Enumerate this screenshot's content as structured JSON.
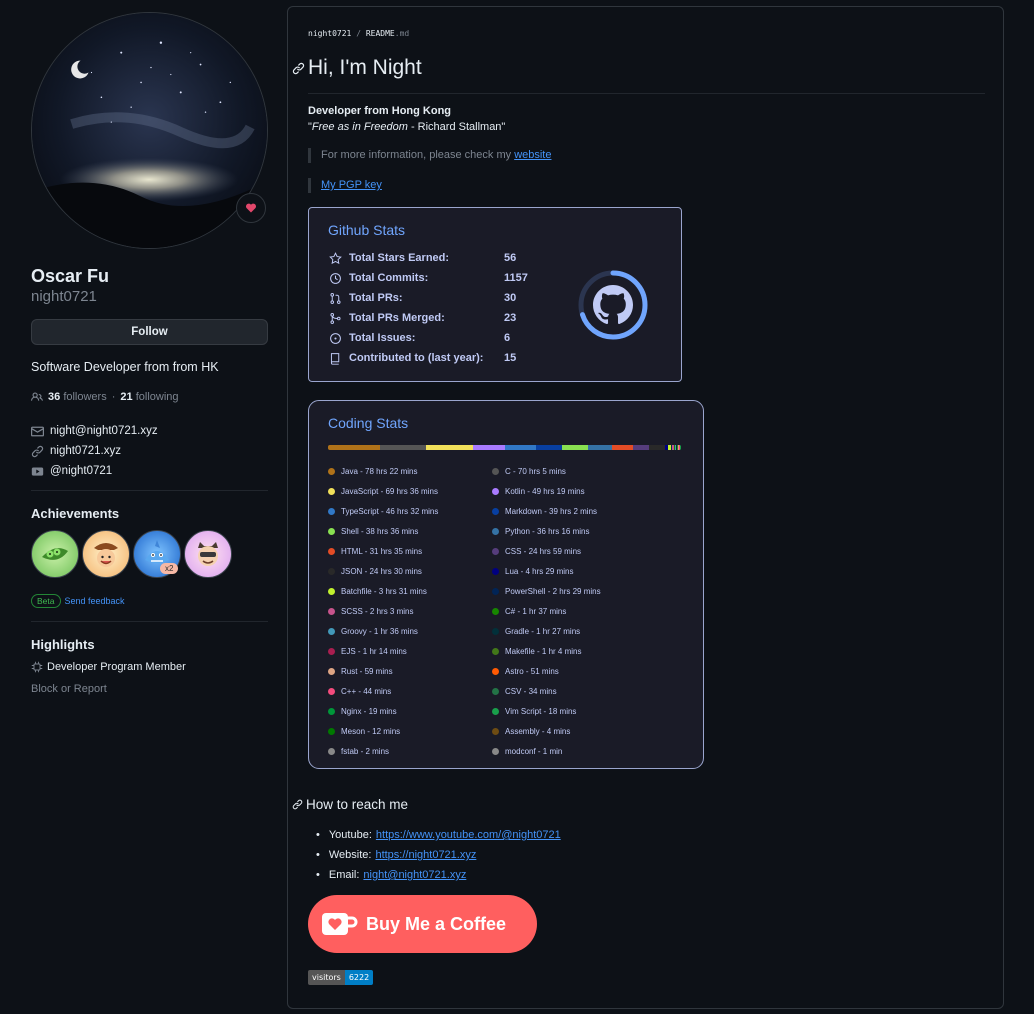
{
  "profile": {
    "name": "Oscar Fu",
    "login": "night0721",
    "follow_label": "Follow",
    "bio": "Software Developer from from HK",
    "followers_count": "36",
    "followers_label": "followers",
    "following_count": "21",
    "following_label": "following",
    "email": "night@night0721.xyz",
    "website": "night0721.xyz",
    "youtube": "@night0721",
    "achievements_title": "Achievements",
    "achievement_x2": "x2",
    "beta_label": "Beta",
    "feedback_label": "Send feedback",
    "highlights_title": "Highlights",
    "highlight_item": "Developer Program Member",
    "block_label": "Block or Report"
  },
  "readme": {
    "crumb_user": "night0721",
    "crumb_sep": "/",
    "crumb_file": "README",
    "crumb_ext": ".md",
    "title": "Hi, I'm Night",
    "developer_line": "Developer from Hong Kong",
    "quote_open": "\"",
    "quote_italic": "Free as in Freedom",
    "quote_rest": " - Richard Stallman\"",
    "info_text": "For more information, please check my ",
    "info_link": "website",
    "pgp_link": "My PGP key",
    "reach_title": "How to reach me",
    "reach": [
      {
        "label": "Youtube:",
        "link": "https://www.youtube.com/@night0721"
      },
      {
        "label": "Website:",
        "link": "https://night0721.xyz"
      },
      {
        "label": "Email:",
        "link": "night@night0721.xyz"
      }
    ],
    "bmc_label": "Buy Me a Coffee",
    "visitors_label": "visitors",
    "visitors_count": "6222"
  },
  "github_stats": {
    "title": "Github Stats",
    "rows": [
      {
        "label": "Total Stars Earned:",
        "value": "56",
        "icon": "star-icon"
      },
      {
        "label": "Total Commits:",
        "value": "1157",
        "icon": "history-icon"
      },
      {
        "label": "Total PRs:",
        "value": "30",
        "icon": "pull-request-icon"
      },
      {
        "label": "Total PRs Merged:",
        "value": "23",
        "icon": "merge-icon"
      },
      {
        "label": "Total Issues:",
        "value": "6",
        "icon": "issue-icon"
      },
      {
        "label": "Contributed to (last year):",
        "value": "15",
        "icon": "repo-icon"
      }
    ],
    "ring_fraction": 0.7,
    "accent": "#70a5fd",
    "text_color": "#c0caf5",
    "bg_color": "#1a1b27"
  },
  "coding_stats": {
    "title": "Coding Stats",
    "languages": [
      {
        "name": "Java",
        "time": "78 hrs 22 mins",
        "color": "#b07219"
      },
      {
        "name": "C",
        "time": "70 hrs 5 mins",
        "color": "#555555"
      },
      {
        "name": "JavaScript",
        "time": "69 hrs 36 mins",
        "color": "#f1e05a"
      },
      {
        "name": "Kotlin",
        "time": "49 hrs 19 mins",
        "color": "#a97bff"
      },
      {
        "name": "TypeScript",
        "time": "46 hrs 32 mins",
        "color": "#3178c6"
      },
      {
        "name": "Markdown",
        "time": "39 hrs 2 mins",
        "color": "#083fa1"
      },
      {
        "name": "Shell",
        "time": "38 hrs 36 mins",
        "color": "#89e051"
      },
      {
        "name": "Python",
        "time": "36 hrs 16 mins",
        "color": "#3572a5"
      },
      {
        "name": "HTML",
        "time": "31 hrs 35 mins",
        "color": "#e34c26"
      },
      {
        "name": "CSS",
        "time": "24 hrs 59 mins",
        "color": "#563d7c"
      },
      {
        "name": "JSON",
        "time": "24 hrs 30 mins",
        "color": "#292929"
      },
      {
        "name": "Lua",
        "time": "4 hrs 29 mins",
        "color": "#000080"
      },
      {
        "name": "Batchfile",
        "time": "3 hrs 31 mins",
        "color": "#c1f12e"
      },
      {
        "name": "PowerShell",
        "time": "2 hrs 29 mins",
        "color": "#012456"
      },
      {
        "name": "SCSS",
        "time": "2 hrs 3 mins",
        "color": "#c6538c"
      },
      {
        "name": "C#",
        "time": "1 hr 37 mins",
        "color": "#178600"
      },
      {
        "name": "Groovy",
        "time": "1 hr 36 mins",
        "color": "#4298b8"
      },
      {
        "name": "Gradle",
        "time": "1 hr 27 mins",
        "color": "#02303a"
      },
      {
        "name": "EJS",
        "time": "1 hr 14 mins",
        "color": "#a91e50"
      },
      {
        "name": "Makefile",
        "time": "1 hr 4 mins",
        "color": "#427819"
      },
      {
        "name": "Rust",
        "time": "59 mins",
        "color": "#dea584"
      },
      {
        "name": "Astro",
        "time": "51 mins",
        "color": "#ff5a03"
      },
      {
        "name": "C++",
        "time": "44 mins",
        "color": "#f34b7d"
      },
      {
        "name": "CSV",
        "time": "34 mins",
        "color": "#237346"
      },
      {
        "name": "Nginx",
        "time": "19 mins",
        "color": "#009639"
      },
      {
        "name": "Vim Script",
        "time": "18 mins",
        "color": "#199f4b"
      },
      {
        "name": "Meson",
        "time": "12 mins",
        "color": "#007800"
      },
      {
        "name": "Assembly",
        "time": "4 mins",
        "color": "#6e4c13"
      },
      {
        "name": "fstab",
        "time": "2 mins",
        "color": "#888888"
      },
      {
        "name": "modconf",
        "time": "1 min",
        "color": "#888888"
      }
    ]
  }
}
